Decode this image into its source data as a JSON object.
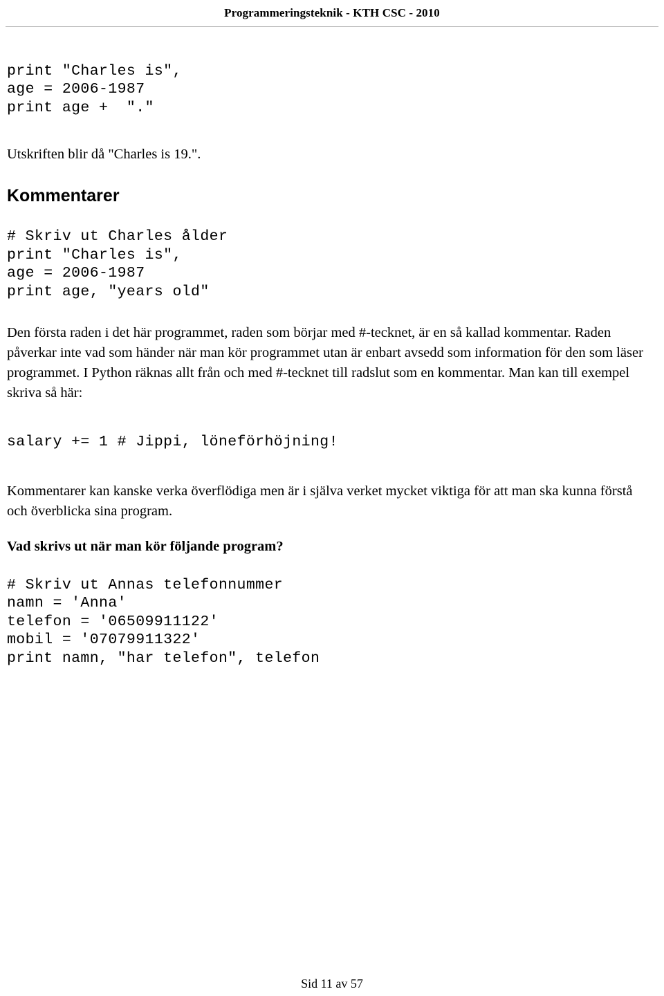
{
  "header": {
    "running_title": "Programmeringsteknik - KTH CSC - 2010"
  },
  "content": {
    "code_block_1": "print \"Charles is\",\nage = 2006-1987\nprint age +  \".\"",
    "paragraph_1": "Utskriften blir då \"Charles is 19.\".",
    "section_heading": "Kommentarer",
    "code_block_2": "# Skriv ut Charles ålder\nprint \"Charles is\",\nage = 2006-1987\nprint age, \"years old\"",
    "paragraph_2": "Den första raden i det här programmet, raden som börjar med #-tecknet, är en så kallad kommentar. Raden påverkar inte vad som händer när man kör programmet utan är enbart avsedd som information för den som läser programmet. I Python räknas allt från och med #-tecknet till radslut som en kommentar. Man kan till exempel skriva så här:",
    "code_block_3": "salary += 1 # Jippi, löneförhöjning!",
    "paragraph_3": "Kommentarer kan kanske verka överflödiga men är i själva verket mycket viktiga för att man ska kunna förstå och överblicka sina program.",
    "question_heading": "Vad skrivs ut när man kör följande program?",
    "code_block_4": "# Skriv ut Annas telefonnummer\nnamn = 'Anna'\ntelefon = '06509911122'\nmobil = '07079911322'\nprint namn, \"har telefon\", telefon"
  },
  "footer": {
    "page_label": "Sid 11 av 57"
  }
}
